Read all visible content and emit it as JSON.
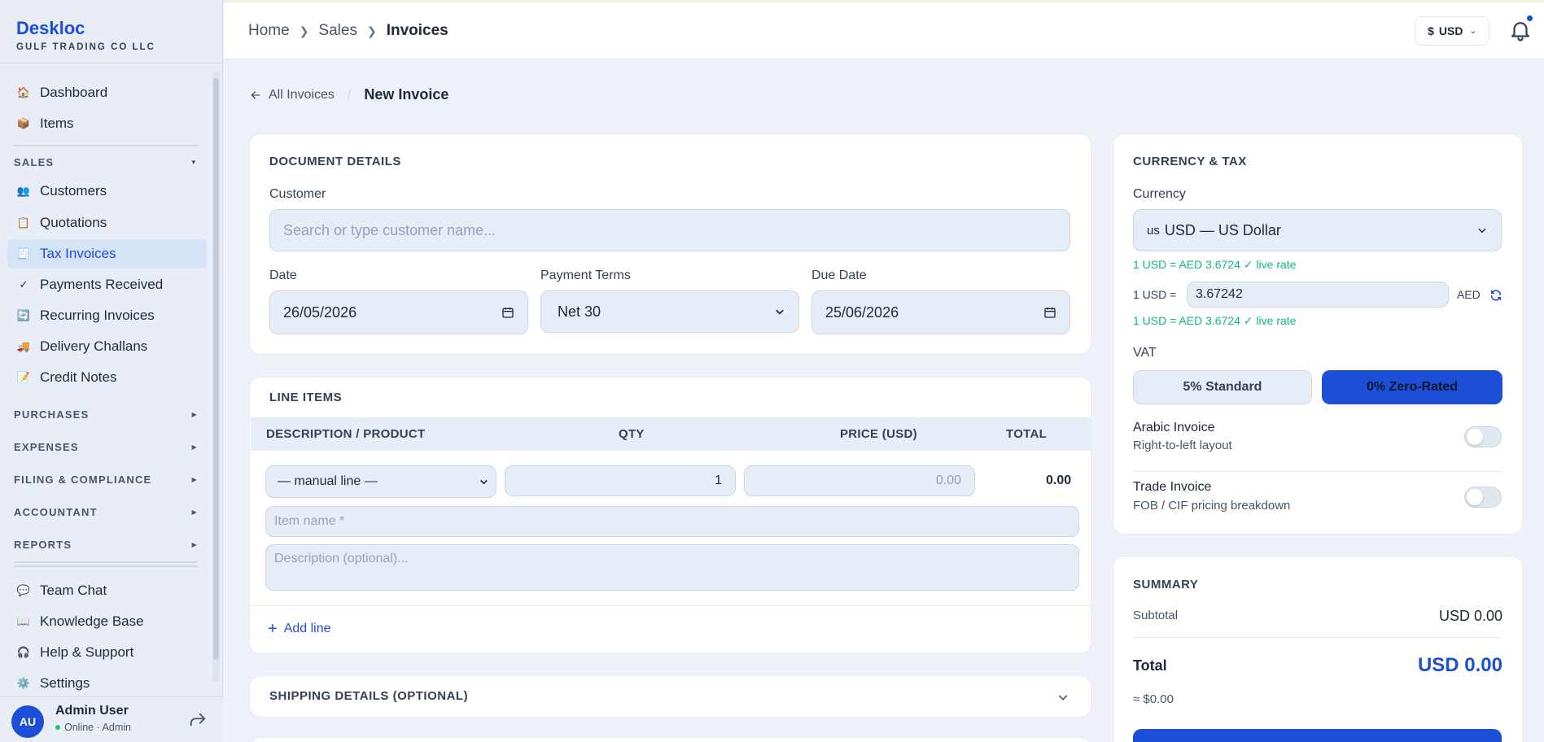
{
  "brand": {
    "name": "Deskloc",
    "company": "GULF TRADING CO LLC"
  },
  "sidebar": {
    "top_items": [
      {
        "label": "Dashboard",
        "icon": "house-icon"
      },
      {
        "label": "Items",
        "icon": "box-icon"
      }
    ],
    "sales_section": "SALES",
    "sales_items": [
      {
        "label": "Customers",
        "icon": "people-icon"
      },
      {
        "label": "Quotations",
        "icon": "clipboard-icon"
      },
      {
        "label": "Tax Invoices",
        "icon": "receipt-icon",
        "active": true
      },
      {
        "label": "Payments Received",
        "icon": "check-icon"
      },
      {
        "label": "Recurring Invoices",
        "icon": "repeat-icon"
      },
      {
        "label": "Delivery Challans",
        "icon": "truck-icon"
      },
      {
        "label": "Credit Notes",
        "icon": "note-icon"
      }
    ],
    "sections": [
      "PURCHASES",
      "EXPENSES",
      "FILING & COMPLIANCE",
      "ACCOUNTANT",
      "REPORTS"
    ],
    "bottom_items": [
      {
        "label": "Team Chat",
        "icon": "chat-icon"
      },
      {
        "label": "Knowledge Base",
        "icon": "book-icon"
      },
      {
        "label": "Help & Support",
        "icon": "headset-icon"
      },
      {
        "label": "Settings",
        "icon": "gear-icon"
      }
    ],
    "user": {
      "initials": "AU",
      "name": "Admin User",
      "status": "Online · Admin"
    }
  },
  "header": {
    "breadcrumbs": [
      "Home",
      "Sales",
      "Invoices"
    ],
    "currency_symbol": "$",
    "currency_code": "USD"
  },
  "subnav": {
    "back_label": "All Invoices",
    "title": "New Invoice"
  },
  "document": {
    "title": "DOCUMENT DETAILS",
    "customer_label": "Customer",
    "customer_placeholder": "Search or type customer name...",
    "date_label": "Date",
    "date_value": "26/05/2026",
    "terms_label": "Payment Terms",
    "terms_value": "Net 30",
    "due_label": "Due Date",
    "due_value": "25/06/2026"
  },
  "line_items": {
    "title": "LINE ITEMS",
    "headers": {
      "desc": "DESCRIPTION / PRODUCT",
      "qty": "QTY",
      "price": "PRICE (USD)",
      "total": "TOTAL"
    },
    "product_value": "— manual line —",
    "qty_value": "1",
    "price_placeholder": "0.00",
    "total_value": "0.00",
    "item_placeholder": "Item name *",
    "desc_placeholder": "Description (optional)...",
    "add_line": "Add line"
  },
  "shipping": {
    "title": "SHIPPING DETAILS (OPTIONAL)"
  },
  "currency_tax": {
    "title": "CURRENCY & TAX",
    "currency_label": "Currency",
    "currency_flag": "us",
    "currency_value": "USD — US Dollar",
    "rate_note_1": "1 USD = AED 3.6724 ✓ live rate",
    "rate_prefix": "1 USD =",
    "rate_value": "3.67242",
    "rate_suffix": "AED",
    "rate_note_2": "1 USD = AED 3.6724 ✓ live rate",
    "vat_label": "VAT",
    "vat_standard": "5% Standard",
    "vat_zero": "0% Zero-Rated",
    "arabic_title": "Arabic Invoice",
    "arabic_sub": "Right-to-left layout",
    "trade_title": "Trade Invoice",
    "trade_sub": "FOB / CIF pricing breakdown"
  },
  "summary": {
    "title": "SUMMARY",
    "subtotal_label": "Subtotal",
    "subtotal_value": "USD 0.00",
    "total_label": "Total",
    "total_value": "USD 0.00",
    "approx": "≈ $0.00"
  },
  "colors": {
    "accent": "#1d4ed8",
    "success": "#10b981",
    "background": "#eef2f8"
  }
}
